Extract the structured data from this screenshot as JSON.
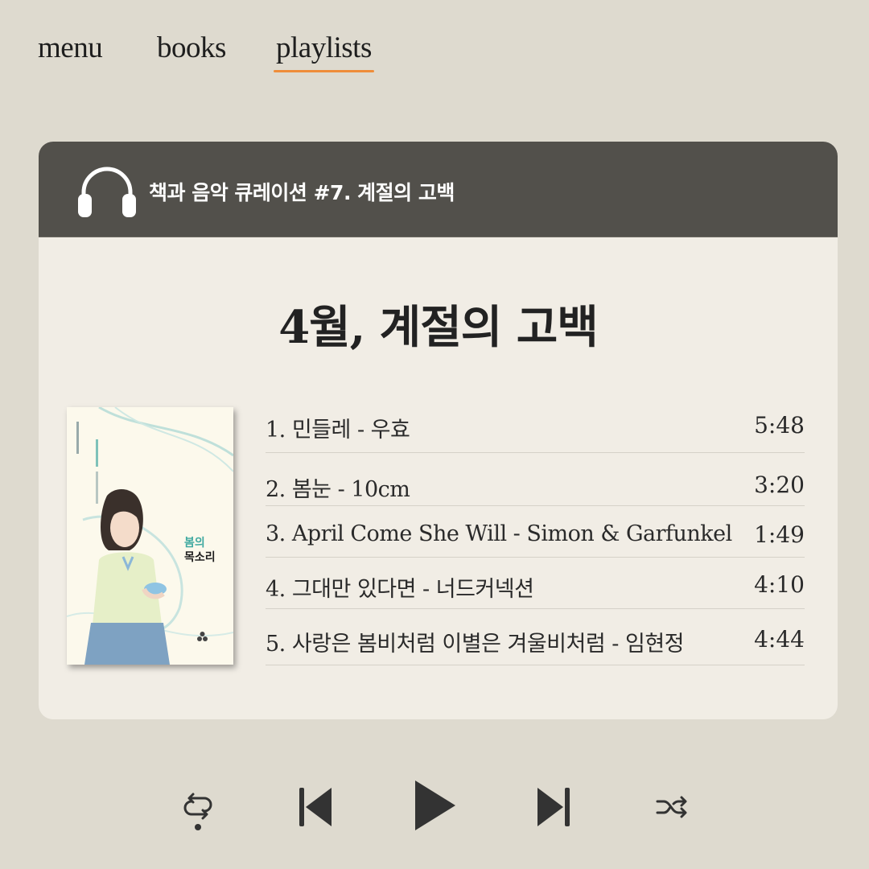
{
  "nav": {
    "items": [
      {
        "label": "menu"
      },
      {
        "label": "books"
      },
      {
        "label": "playlists",
        "active": true
      }
    ]
  },
  "card": {
    "header_icon": "headphones-icon",
    "title": "책과 음악 큐레이션 #7. 계절의 고백",
    "playlist_heading": "4월, 계절의 고백",
    "book_cover": {
      "title_line1": "봄의",
      "title_line2": "목소리"
    },
    "tracks": [
      {
        "title": "1. 민들레 - 우효",
        "time": "5:48"
      },
      {
        "title": "2. 봄눈 - 10cm",
        "time": "3:20"
      },
      {
        "title": "3. April Come She Will - Simon & Garfunkel",
        "time": "1:49"
      },
      {
        "title": "4. 그대만 있다면 - 너드커넥션",
        "time": "4:10"
      },
      {
        "title": "5. 사랑은 봄비처럼 이별은 겨울비처럼 - 임현정",
        "time": "4:44"
      }
    ]
  },
  "player": {
    "controls": [
      "repeat-icon",
      "previous-icon",
      "play-icon",
      "next-icon",
      "shuffle-icon"
    ]
  },
  "colors": {
    "background": "#dedacf",
    "card": "#f1ede5",
    "header": "#52504b",
    "accent": "#ef8d3a"
  }
}
